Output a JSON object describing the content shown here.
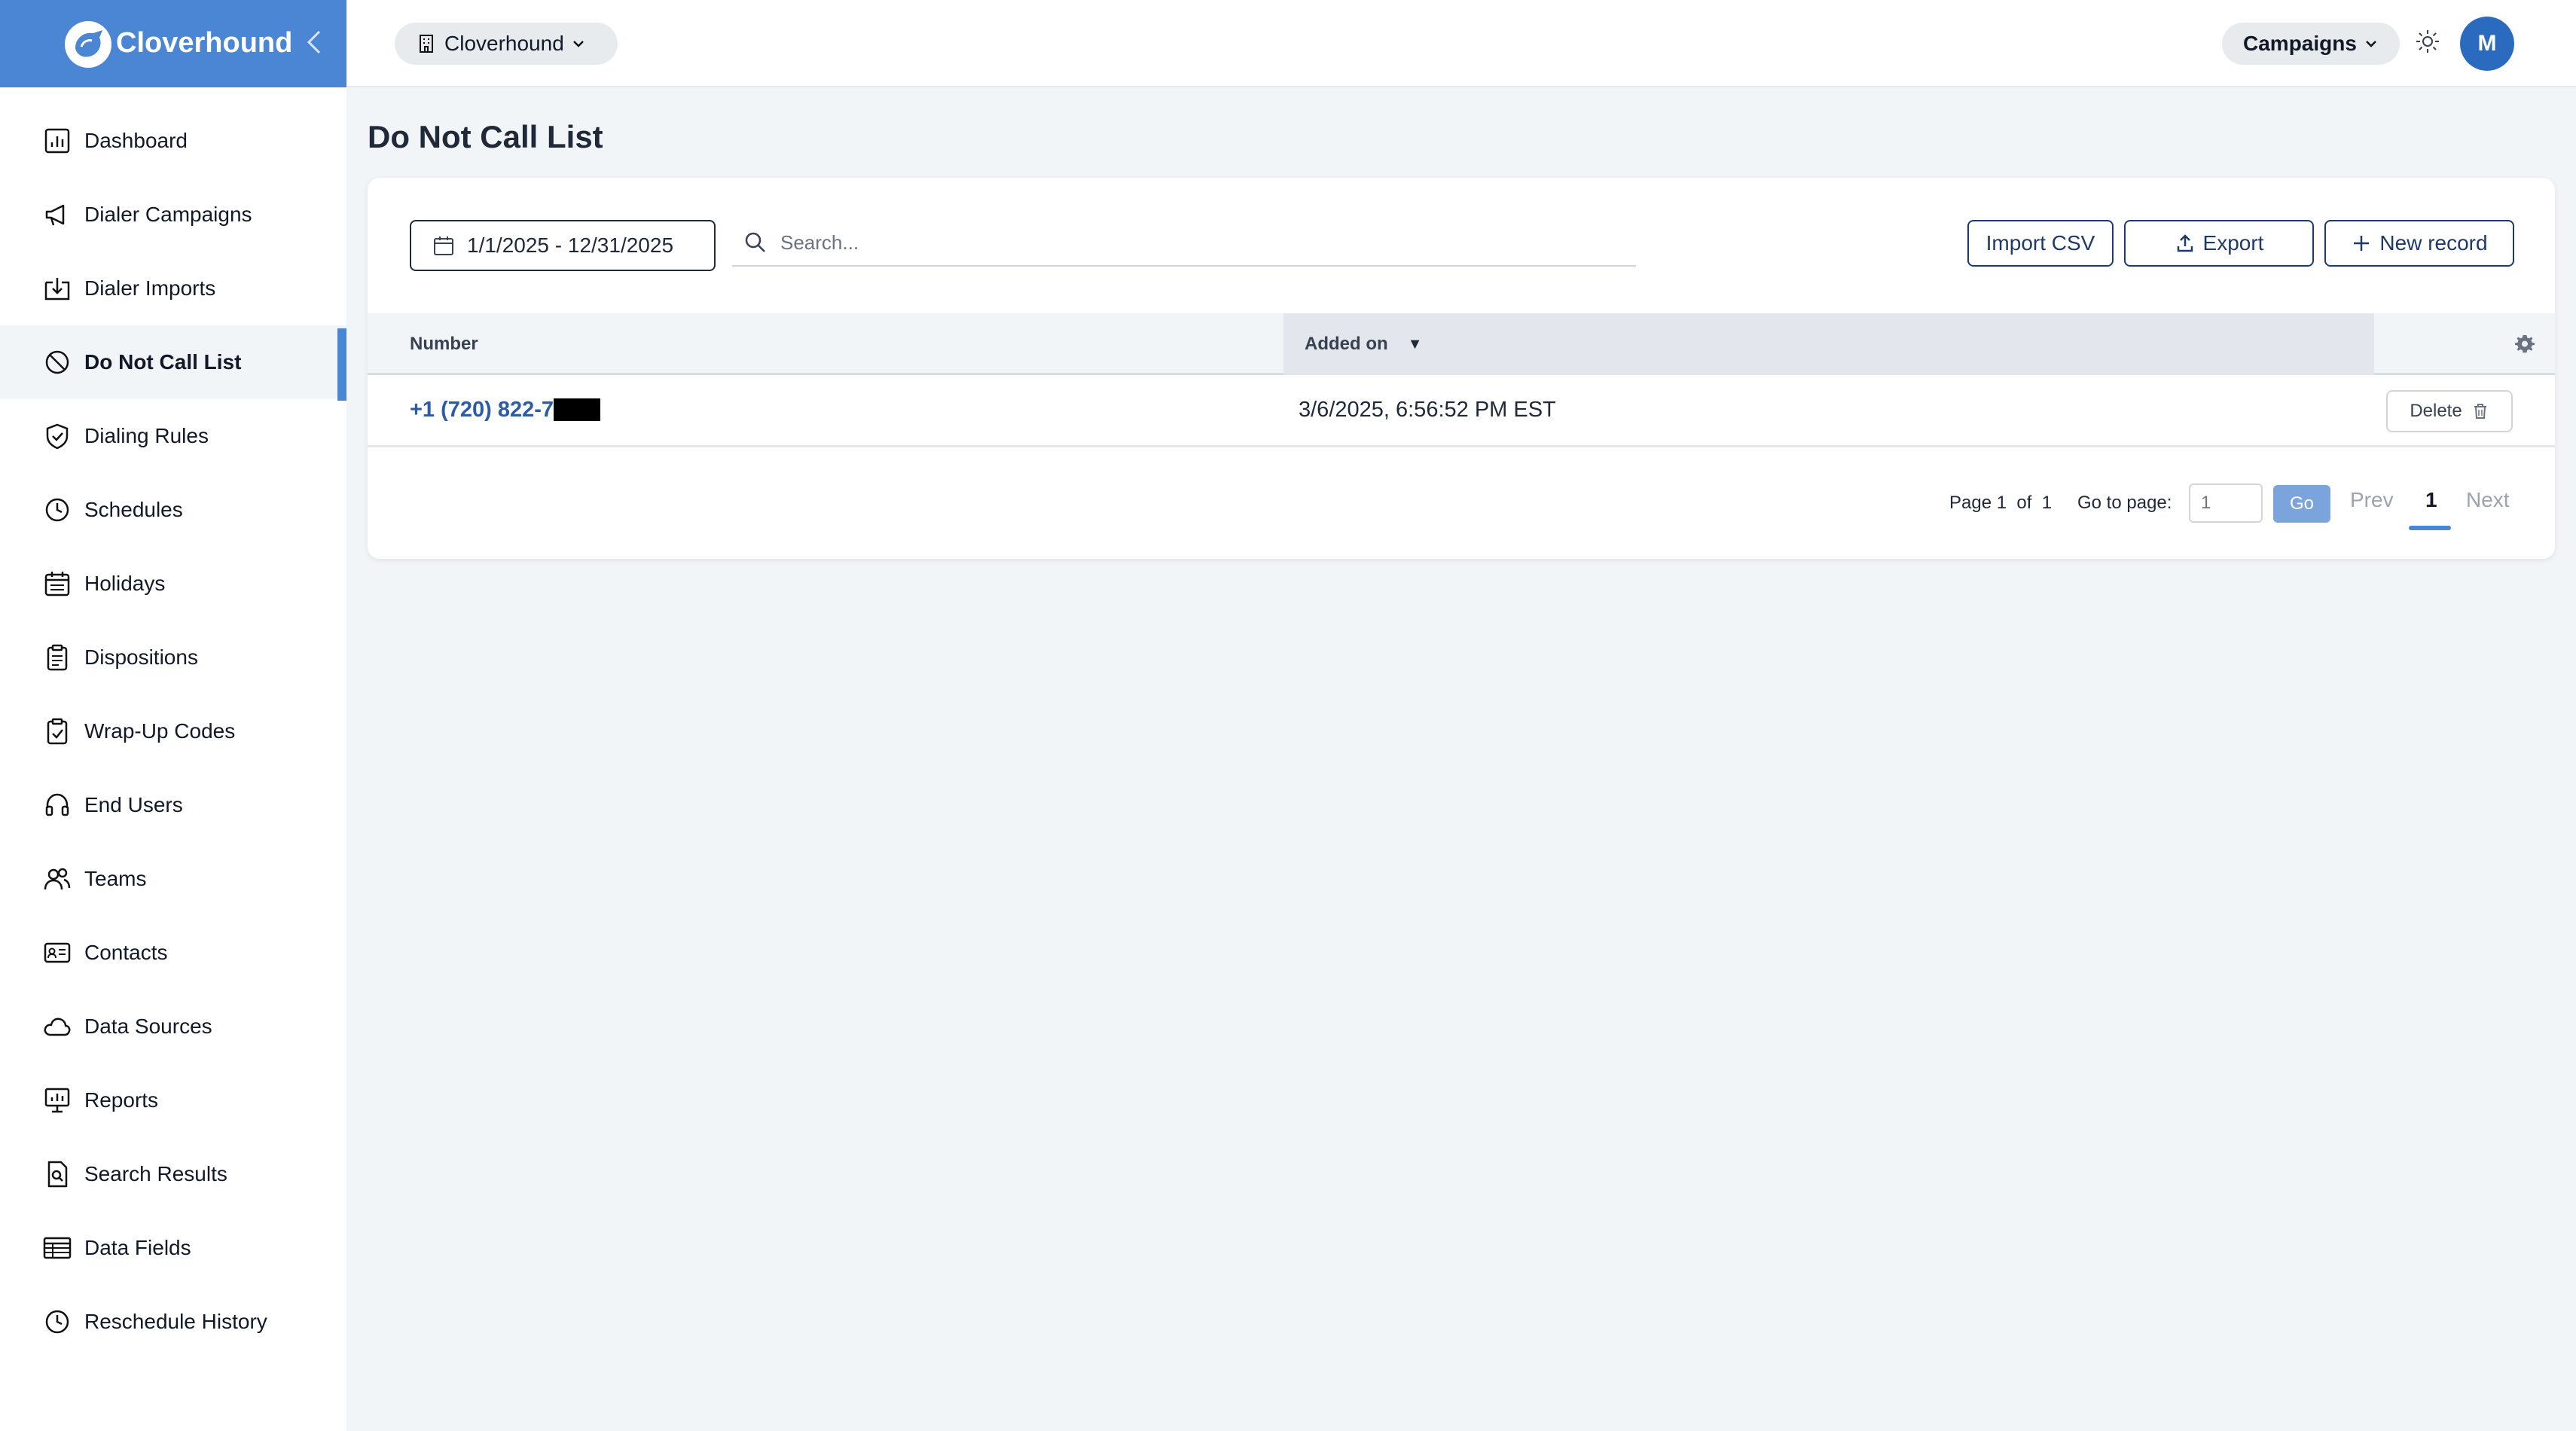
{
  "brand": {
    "name": "Cloverhound"
  },
  "sidebar": {
    "items": [
      {
        "label": "Dashboard",
        "icon": "chart-icon"
      },
      {
        "label": "Dialer Campaigns",
        "icon": "megaphone-icon"
      },
      {
        "label": "Dialer Imports",
        "icon": "import-icon"
      },
      {
        "label": "Do Not Call List",
        "icon": "block-icon",
        "active": true
      },
      {
        "label": "Dialing Rules",
        "icon": "shield-icon"
      },
      {
        "label": "Schedules",
        "icon": "clock-icon"
      },
      {
        "label": "Holidays",
        "icon": "calendar-icon"
      },
      {
        "label": "Dispositions",
        "icon": "clipboard-icon"
      },
      {
        "label": "Wrap-Up Codes",
        "icon": "clipboard-check-icon"
      },
      {
        "label": "End Users",
        "icon": "headset-icon"
      },
      {
        "label": "Teams",
        "icon": "users-icon"
      },
      {
        "label": "Contacts",
        "icon": "id-card-icon"
      },
      {
        "label": "Data Sources",
        "icon": "cloud-icon"
      },
      {
        "label": "Reports",
        "icon": "presentation-icon"
      },
      {
        "label": "Search Results",
        "icon": "file-search-icon"
      },
      {
        "label": "Data Fields",
        "icon": "table-icon"
      },
      {
        "label": "Reschedule History",
        "icon": "clock-icon"
      }
    ]
  },
  "topbar": {
    "org": "Cloverhound",
    "campaigns": "Campaigns",
    "avatar_initial": "M"
  },
  "page": {
    "title": "Do Not Call List"
  },
  "toolbar": {
    "date_range": "1/1/2025 - 12/31/2025",
    "search_placeholder": "Search...",
    "import_label": "Import CSV",
    "export_label": "Export",
    "new_label": "New record"
  },
  "table": {
    "columns": [
      "Number",
      "Added on"
    ],
    "sort_indicator": "▼",
    "rows": [
      {
        "number": "+1 (720) 822-7",
        "added_on": "3/6/2025, 6:56:52 PM EST",
        "action": "Delete"
      }
    ]
  },
  "pagination": {
    "page_text": "Page 1  of  1",
    "goto_label": "Go to page:",
    "goto_value": "1",
    "go_label": "Go",
    "prev_label": "Prev",
    "current": "1",
    "next_label": "Next"
  },
  "colors": {
    "accent": "#4a86d4",
    "link": "#2b5ca8",
    "button_border": "#1e3a6b",
    "avatar": "#2b6bbf"
  }
}
